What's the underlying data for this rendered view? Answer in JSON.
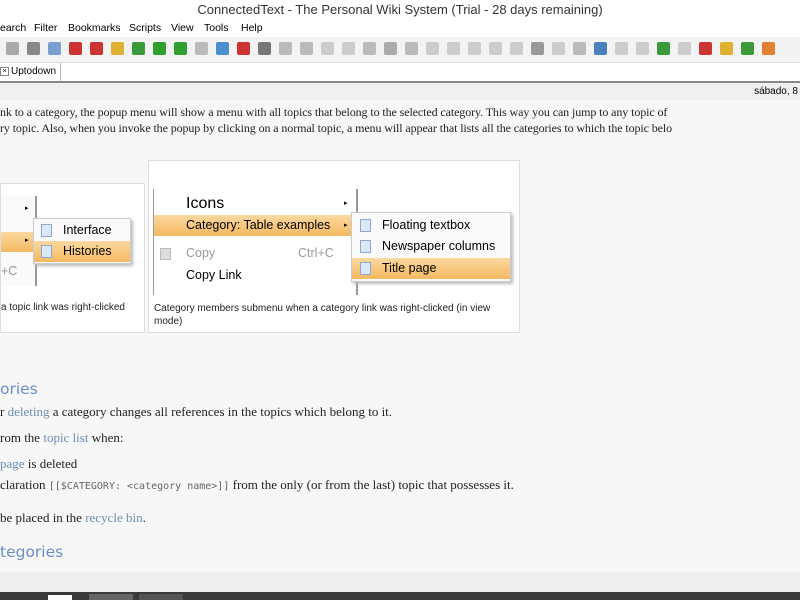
{
  "window": {
    "title": "ConnectedText - The Personal Wiki System   (Trial - 28 days remaining)"
  },
  "menu": [
    "earch",
    "Filter",
    "Bookmarks",
    "Scripts",
    "View",
    "Tools",
    "Help"
  ],
  "toolbar_icons": [
    [
      "save-icon",
      "#aaa"
    ],
    [
      "print-icon",
      "#888"
    ],
    [
      "edit-icon",
      "#7a9fd0"
    ],
    [
      "spellcheck-icon",
      "#c33"
    ],
    [
      "delete-topic-icon",
      "#c33"
    ],
    [
      "lock-icon",
      "#e0b030"
    ],
    [
      "home-icon",
      "#3a9a3a"
    ],
    [
      "forward-icon",
      "#2fa02f"
    ],
    [
      "back-icon",
      "#2fa02f"
    ],
    [
      "stop-icon",
      "#bbb"
    ],
    [
      "refresh-icon",
      "#4a8fd0"
    ],
    [
      "help-icon",
      "#c33"
    ],
    [
      "network-icon",
      "#777"
    ],
    [
      "undo-icon",
      "#bbb"
    ],
    [
      "redo-icon",
      "#bbb"
    ],
    [
      "cut-icon",
      "#ccc"
    ],
    [
      "copy-icon",
      "#ccc"
    ],
    [
      "paste-icon",
      "#bbb"
    ],
    [
      "delete-icon",
      "#aaa"
    ],
    [
      "columns-icon",
      "#bbb"
    ],
    [
      "bold-icon",
      "#ccc"
    ],
    [
      "italic-icon",
      "#ccc"
    ],
    [
      "underline-icon",
      "#ccc"
    ],
    [
      "superscript-icon",
      "#ccc"
    ],
    [
      "subscript-icon",
      "#ccc"
    ],
    [
      "font-color-icon",
      "#999"
    ],
    [
      "highlight-icon",
      "#ccc"
    ],
    [
      "format-icon",
      "#bbb"
    ],
    [
      "find-icon",
      "#4a7fc0"
    ],
    [
      "find-next-icon",
      "#ccc"
    ],
    [
      "find-prev-icon",
      "#ccc"
    ],
    [
      "replace-icon",
      "#3a9a3a"
    ],
    [
      "spell-icon",
      "#ccc"
    ],
    [
      "note-icon",
      "#c33"
    ],
    [
      "topics-icon",
      "#e0b030"
    ],
    [
      "filter-icon",
      "#3a9a3a"
    ],
    [
      "export-icon",
      "#e08030"
    ]
  ],
  "tab": {
    "label": "Uptodown"
  },
  "date": "sábado, 8",
  "body": {
    "intro_1": "nk to a category, the popup menu will show a menu with all topics that belong to the selected category. This way you can jump to any topic of",
    "intro_2": "ry topic. Also, when you invoke the popup by clicking on a normal topic, a menu will appear that lists all the categories to which the topic belo",
    "fig1": {
      "submenu": [
        "Interface",
        "Histories"
      ],
      "shortcut": "+C",
      "caption": "a topic link was right-clicked"
    },
    "fig2": {
      "menu": [
        "Icons",
        "Category: Table examples",
        "Copy",
        "Copy Link"
      ],
      "copy_shortcut": "Ctrl+C",
      "submenu": [
        "Floating textbox",
        "Newspaper columns",
        "Title page"
      ],
      "caption": "Category members submenu when a category link was right-clicked (in view mode)"
    },
    "h1": "ories",
    "p1_link": "deleting",
    "p1": " a category changes all references in the topics which belong to it.",
    "p1_pre": "r ",
    "p2_pre": "rom the ",
    "p2_link": "topic list",
    "p2": " when:",
    "li1_link": "page",
    "li1": " is deleted",
    "li2_pre": "claration ",
    "li2_code": "[[$CATEGORY: <category name>]]",
    "li2": " from the only (or from the last) topic that possesses it.",
    "p3_pre": "be placed in the ",
    "p3_link": "recycle bin",
    "p3": ".",
    "h2": "tegories"
  }
}
